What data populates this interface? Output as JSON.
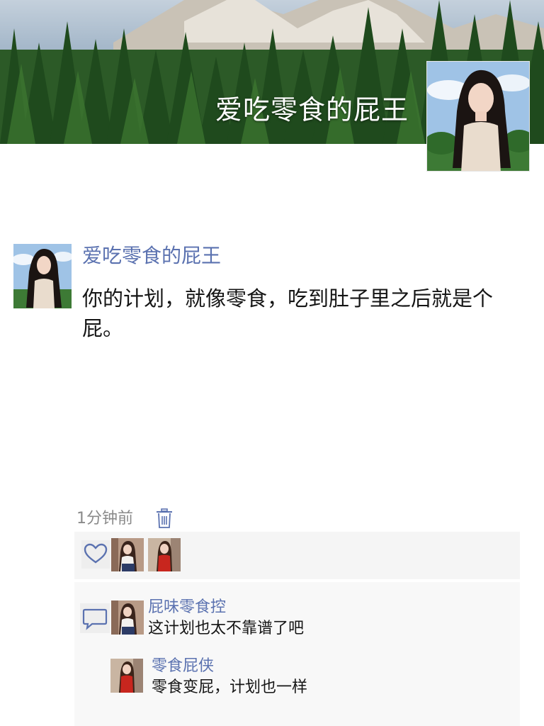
{
  "cover": {
    "title": "爱吃零食的屁王",
    "background": "mountain-forest-photo"
  },
  "post": {
    "author": "爱吃零食的屁王",
    "text": "你的计划，就像零食，吃到肚子里之后就是个屁。",
    "time": "1分钟前"
  },
  "icons": {
    "delete": "trash-icon",
    "like": "heart-icon",
    "comment": "comment-bubble-icon"
  },
  "likes": {
    "count": 2
  },
  "comments": [
    {
      "author": "屁味零食控",
      "text": "这计划也太不靠谱了吧"
    },
    {
      "author": "零食屁侠",
      "text": "零食变屁，计划也一样"
    }
  ],
  "colors": {
    "link": "#5b72b0",
    "panel": "#f5f5f5",
    "meta": "#8a8a8a",
    "icon": "#5b72b0"
  }
}
